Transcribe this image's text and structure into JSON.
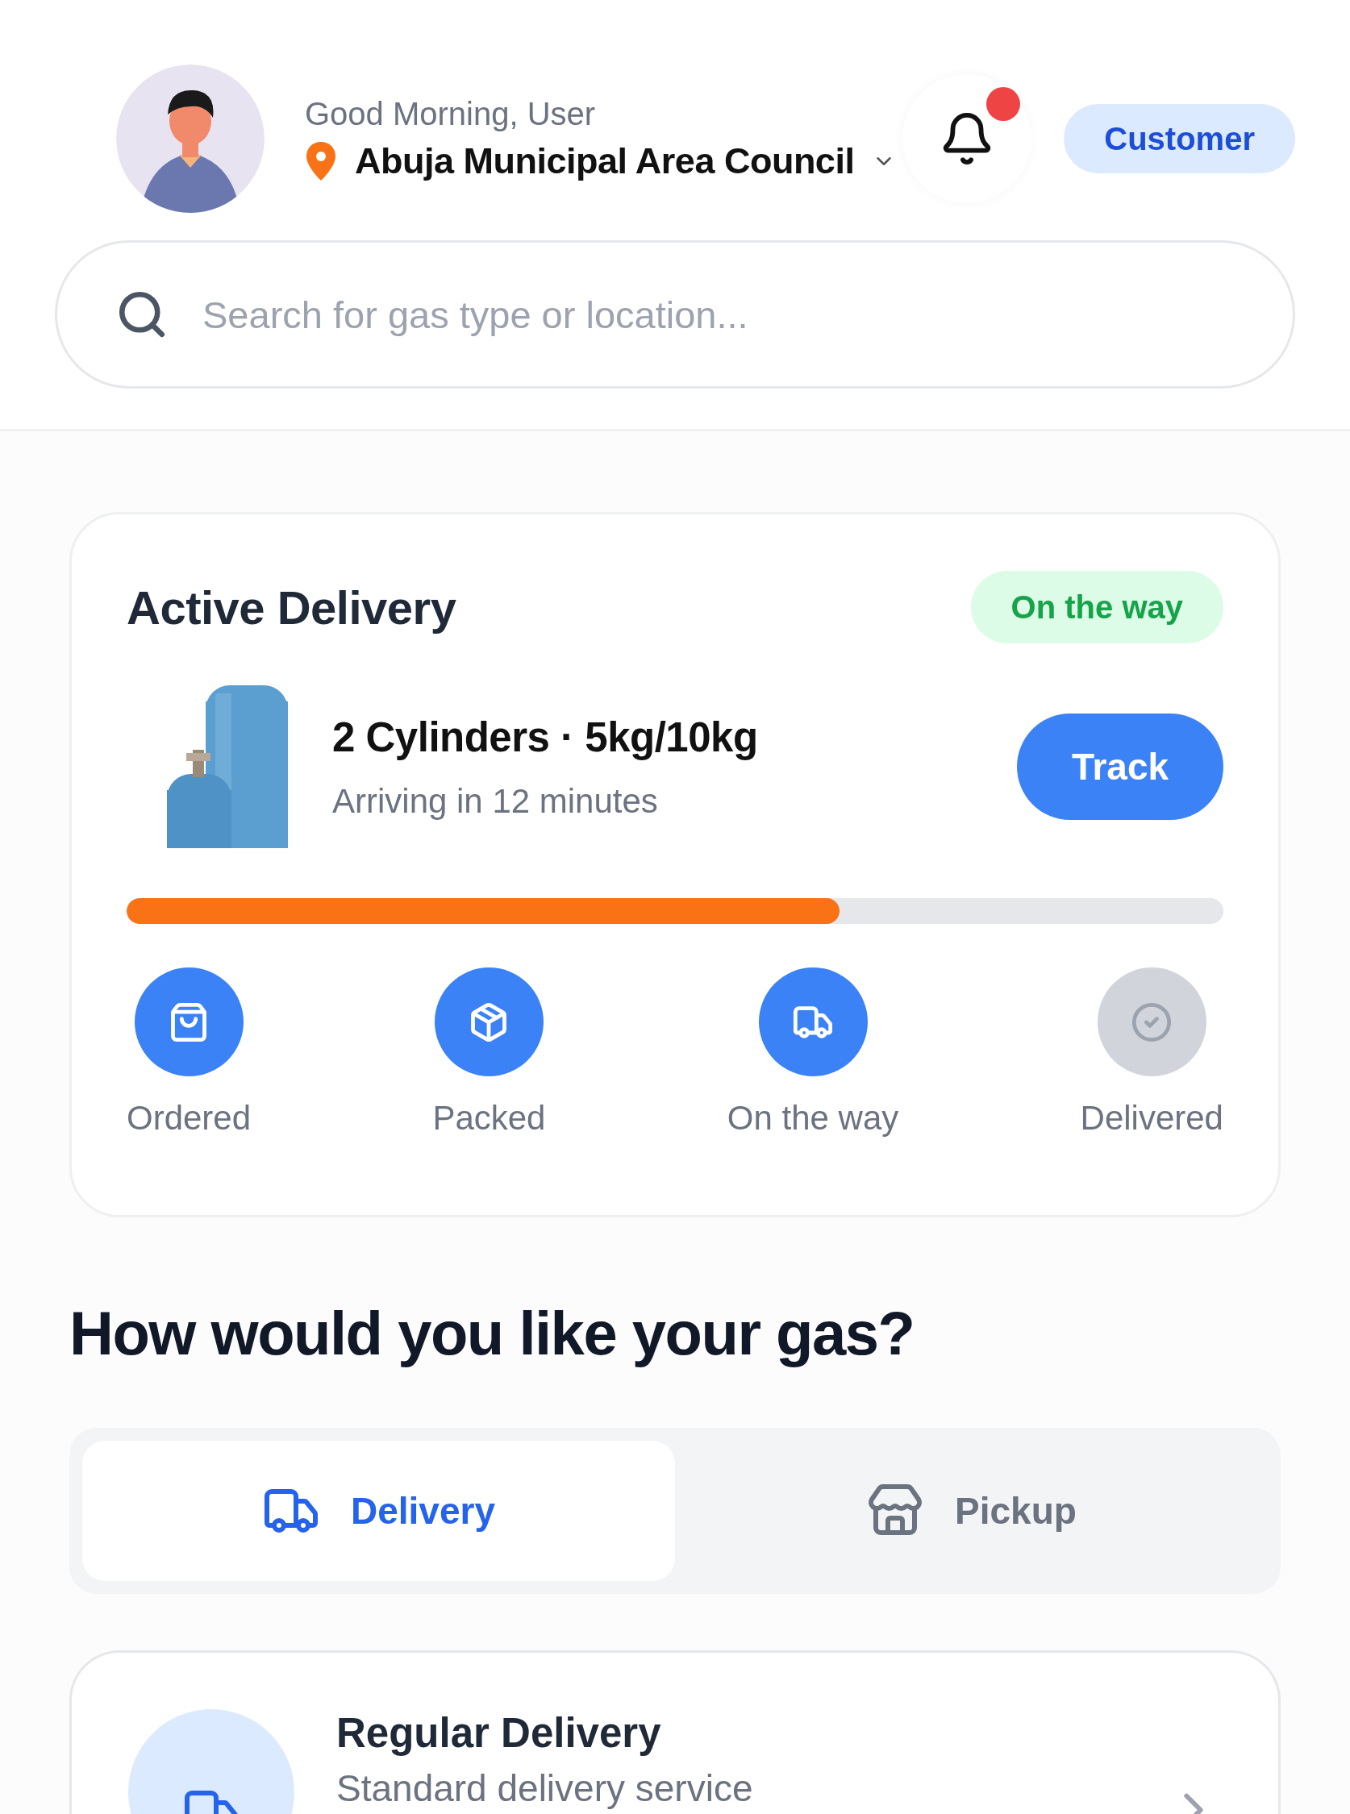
{
  "header": {
    "greeting": "Good Morning, User",
    "location": "Abuja Municipal Area Council",
    "unread_notifications": true,
    "role": "Customer"
  },
  "search": {
    "placeholder": "Search for gas type or location..."
  },
  "active_delivery": {
    "title": "Active Delivery",
    "status": "On the way",
    "item": "2 Cylinders · 5kg/10kg",
    "eta": "Arriving in 12 minutes",
    "action": "Track",
    "progress": {
      "level": 0.65
    },
    "steps": [
      {
        "label": "Ordered",
        "kind": "bag",
        "done": true
      },
      {
        "label": "Packed",
        "kind": "box",
        "done": true
      },
      {
        "label": "On the way",
        "kind": "truck",
        "done": true
      },
      {
        "label": "Delivered",
        "kind": "check",
        "done": false
      }
    ]
  },
  "gas_section": {
    "heading": "How would you like your gas?",
    "tabs": [
      {
        "label": "Delivery",
        "kind": "delivery",
        "selected": true
      },
      {
        "label": "Pickup",
        "kind": "pickup",
        "selected": false
      }
    ],
    "options": [
      {
        "title": "Regular Delivery",
        "subtitle": "Standard delivery service",
        "kind": "delivery"
      }
    ]
  }
}
